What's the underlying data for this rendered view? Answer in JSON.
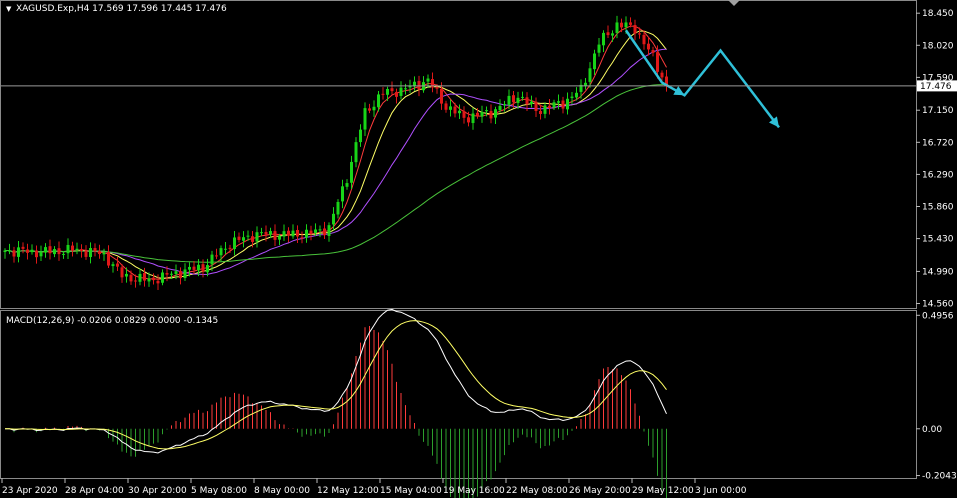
{
  "chart_data": [
    {
      "type": "candlestick",
      "header": "XAGUSD.Exp,H4  17.569 17.596 17.445 17.476",
      "current_price_label": "17.476",
      "ylim": [
        14.5,
        18.6
      ],
      "y_ticks": [
        {
          "value": 18.45,
          "label": "18.450"
        },
        {
          "value": 18.02,
          "label": "18.020"
        },
        {
          "value": 17.59,
          "label": "17.590"
        },
        {
          "value": 17.15,
          "label": "17.150"
        },
        {
          "value": 16.72,
          "label": "16.720"
        },
        {
          "value": 16.29,
          "label": "16.290"
        },
        {
          "value": 15.86,
          "label": "15.860"
        },
        {
          "value": 15.43,
          "label": "15.430"
        },
        {
          "value": 14.99,
          "label": "14.990"
        },
        {
          "value": 14.56,
          "label": "14.560"
        }
      ],
      "x_ticks": [
        "23 Apr 2020",
        "28 Apr 04:00",
        "30 Apr 20:00",
        "5 May 08:00",
        "8 May 00:00",
        "12 May 12:00",
        "15 May 04:00",
        "19 May 16:00",
        "22 May 08:00",
        "26 May 20:00",
        "29 May 12:00",
        "3 Jun 00:00"
      ],
      "anchors": [
        [
          0,
          15.27
        ],
        [
          8,
          15.25
        ],
        [
          16,
          15.28
        ],
        [
          22,
          15.22
        ],
        [
          26,
          14.93
        ],
        [
          32,
          14.87
        ],
        [
          38,
          14.97
        ],
        [
          44,
          15.05
        ],
        [
          50,
          15.37
        ],
        [
          56,
          15.49
        ],
        [
          62,
          15.48
        ],
        [
          68,
          15.5
        ],
        [
          72,
          15.58
        ],
        [
          76,
          16.25
        ],
        [
          80,
          17.12
        ],
        [
          84,
          17.38
        ],
        [
          88,
          17.42
        ],
        [
          94,
          17.55
        ],
        [
          98,
          17.2
        ],
        [
          102,
          17.05
        ],
        [
          108,
          17.12
        ],
        [
          114,
          17.35
        ],
        [
          118,
          17.15
        ],
        [
          124,
          17.25
        ],
        [
          128,
          17.42
        ],
        [
          132,
          18.05
        ],
        [
          136,
          18.3
        ],
        [
          140,
          18.25
        ],
        [
          144,
          17.85
        ],
        [
          147,
          17.48
        ]
      ],
      "ma_periods": [
        5,
        10,
        20,
        60
      ],
      "ma_colors": [
        "#ff3b3b",
        "#ffff66",
        "#b050ff",
        "#49c23a"
      ],
      "up_color": "#18d418",
      "down_color": "#e01818",
      "forecast_arrow": {
        "color": "#2fc0d8",
        "points": [
          [
            138,
            18.22
          ],
          [
            146,
            17.52
          ],
          [
            151,
            17.35
          ],
          [
            159,
            17.95
          ],
          [
            172,
            16.92
          ]
        ]
      }
    },
    {
      "type": "macd",
      "header": "MACD(12,26,9) -0.0206 0.0829 0.0000 -0.1345",
      "ylim": [
        -0.215,
        0.51
      ],
      "y_ticks": [
        {
          "value": 0.4956,
          "label": "0.4956"
        },
        {
          "value": 0.0,
          "label": "0.00"
        },
        {
          "value": -0.2043,
          "label": "-0.2043"
        }
      ],
      "macd_color": "#ffffff",
      "signal_color": "#ffff66",
      "hist_pos_color": "#ff3b3b",
      "hist_neg_color": "#2c9e2c"
    }
  ]
}
